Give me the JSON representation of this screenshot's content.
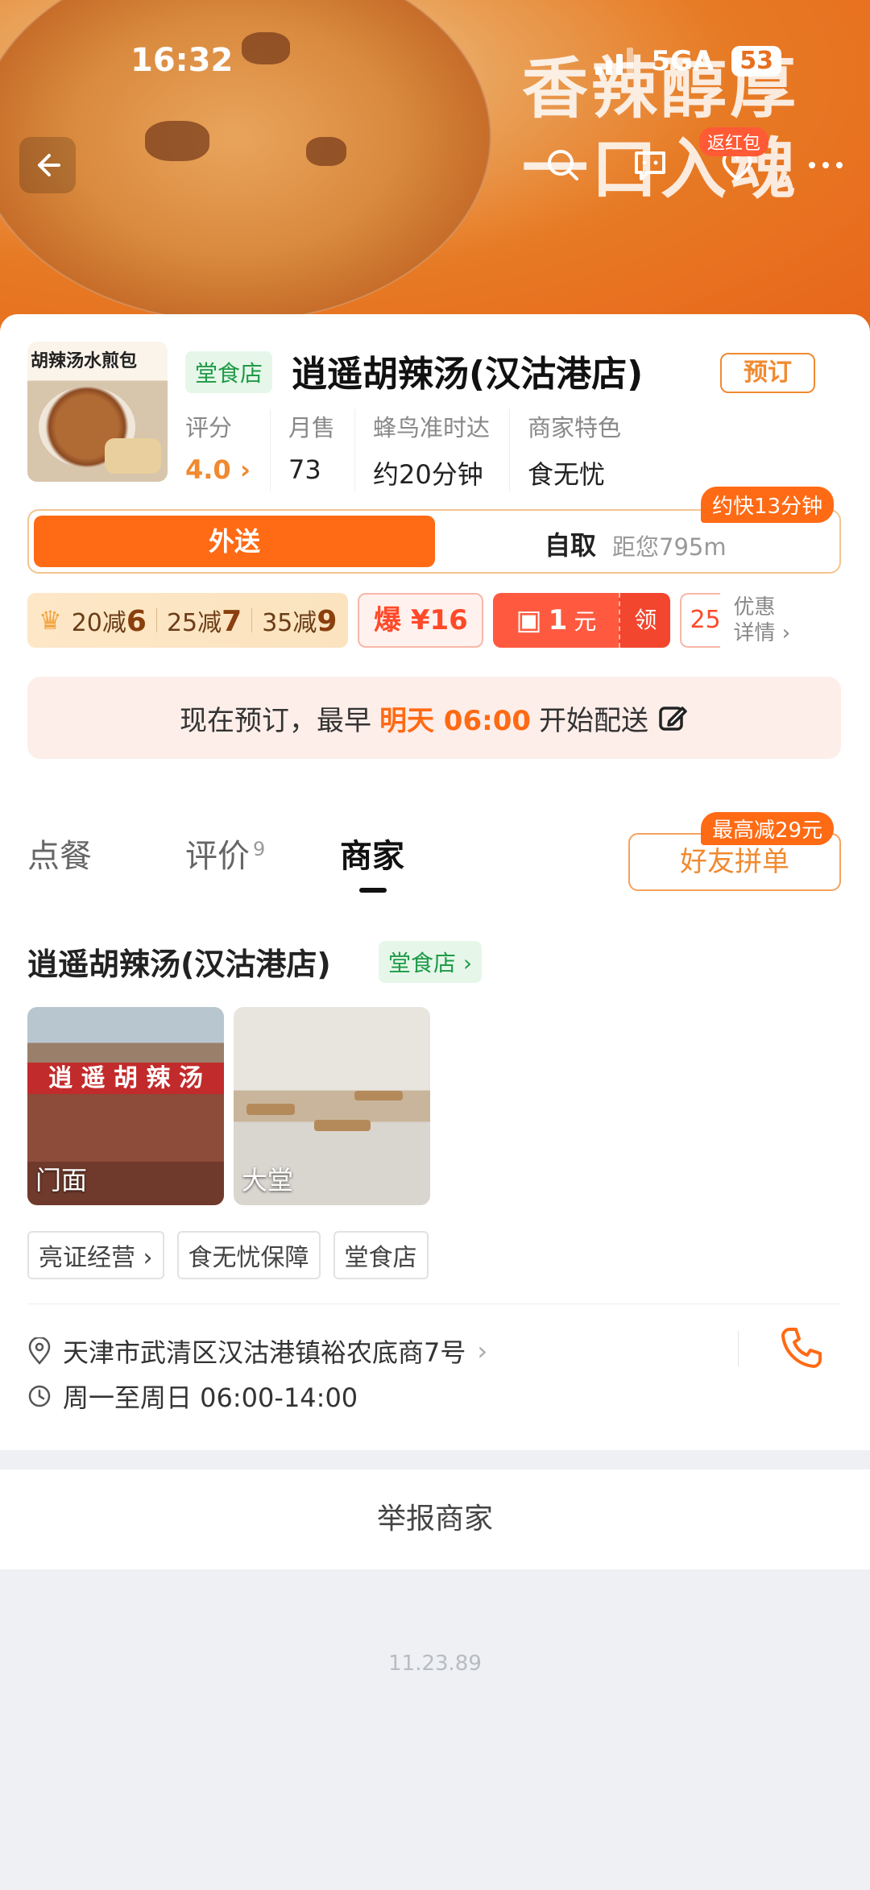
{
  "status_bar": {
    "time": "16:32",
    "network": "5GA",
    "battery": "53"
  },
  "hero": {
    "slogan_line1": "香辣醇厚",
    "slogan_line2": "一口入魂",
    "redpacket_label": "返红包"
  },
  "shop": {
    "logo_text": "胡辣汤水煎包",
    "type_tag": "堂食店",
    "name": "逍遥胡辣汤(汉沽港店)",
    "reserve_label": "预订",
    "stats": [
      {
        "label": "评分",
        "value": "4.0",
        "suffix": "›"
      },
      {
        "label": "月售",
        "value": "73"
      },
      {
        "label": "蜂鸟准时达",
        "value": "约20分钟"
      },
      {
        "label": "商家特色",
        "value": "食无忧"
      }
    ]
  },
  "mode": {
    "deliver": "外送",
    "pickup": "自取",
    "distance": "距您795m",
    "fast_tag": "约快13分钟"
  },
  "promos": {
    "full_reduce": [
      {
        "cond": "20减",
        "amt": "6"
      },
      {
        "cond": "25减",
        "amt": "7"
      },
      {
        "cond": "35减",
        "amt": "9"
      }
    ],
    "bao": "爆 ¥16",
    "coupon_amount": "1",
    "coupon_unit": "元",
    "coupon_action": "领",
    "partial": "25",
    "more_line1": "优惠",
    "more_line2": "详情"
  },
  "notice": {
    "prefix": "现在预订，最早",
    "time": "明天 06:00",
    "suffix": "开始配送"
  },
  "tabs": {
    "order": "点餐",
    "reviews": "评价",
    "reviews_count": "9",
    "merchant": "商家"
  },
  "group": {
    "label": "好友拼单",
    "tag": "最高减29元"
  },
  "merchant": {
    "name": "逍遥胡辣汤(汉沽港店)",
    "tag": "堂食店 ›",
    "photos": [
      {
        "caption": "门面",
        "sign": "逍 遥 胡 辣 汤"
      },
      {
        "caption": "大堂"
      }
    ],
    "chips": [
      "亮证经营 ›",
      "食无忧保障",
      "堂食店"
    ],
    "address": "天津市武清区汉沽港镇裕农底商7号",
    "hours": "周一至周日 06:00-14:00"
  },
  "report_label": "举报商家",
  "version": "11.23.89",
  "colors": {
    "accent": "#ff6a14",
    "green_tag": "#1f9a46"
  }
}
